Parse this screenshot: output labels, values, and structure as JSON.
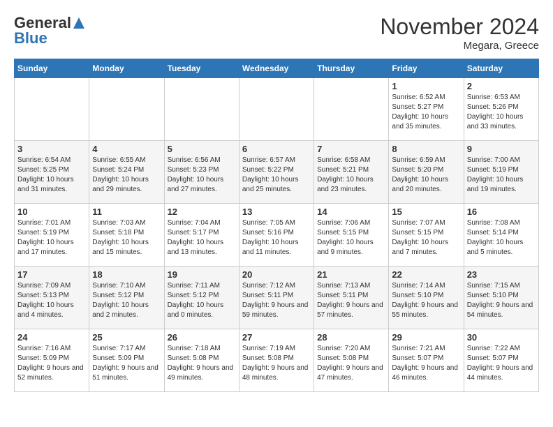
{
  "header": {
    "logo_general": "General",
    "logo_blue": "Blue",
    "month": "November 2024",
    "location": "Megara, Greece"
  },
  "weekdays": [
    "Sunday",
    "Monday",
    "Tuesday",
    "Wednesday",
    "Thursday",
    "Friday",
    "Saturday"
  ],
  "weeks": [
    [
      {
        "day": "",
        "info": ""
      },
      {
        "day": "",
        "info": ""
      },
      {
        "day": "",
        "info": ""
      },
      {
        "day": "",
        "info": ""
      },
      {
        "day": "",
        "info": ""
      },
      {
        "day": "1",
        "info": "Sunrise: 6:52 AM\nSunset: 5:27 PM\nDaylight: 10 hours and 35 minutes."
      },
      {
        "day": "2",
        "info": "Sunrise: 6:53 AM\nSunset: 5:26 PM\nDaylight: 10 hours and 33 minutes."
      }
    ],
    [
      {
        "day": "3",
        "info": "Sunrise: 6:54 AM\nSunset: 5:25 PM\nDaylight: 10 hours and 31 minutes."
      },
      {
        "day": "4",
        "info": "Sunrise: 6:55 AM\nSunset: 5:24 PM\nDaylight: 10 hours and 29 minutes."
      },
      {
        "day": "5",
        "info": "Sunrise: 6:56 AM\nSunset: 5:23 PM\nDaylight: 10 hours and 27 minutes."
      },
      {
        "day": "6",
        "info": "Sunrise: 6:57 AM\nSunset: 5:22 PM\nDaylight: 10 hours and 25 minutes."
      },
      {
        "day": "7",
        "info": "Sunrise: 6:58 AM\nSunset: 5:21 PM\nDaylight: 10 hours and 23 minutes."
      },
      {
        "day": "8",
        "info": "Sunrise: 6:59 AM\nSunset: 5:20 PM\nDaylight: 10 hours and 20 minutes."
      },
      {
        "day": "9",
        "info": "Sunrise: 7:00 AM\nSunset: 5:19 PM\nDaylight: 10 hours and 19 minutes."
      }
    ],
    [
      {
        "day": "10",
        "info": "Sunrise: 7:01 AM\nSunset: 5:19 PM\nDaylight: 10 hours and 17 minutes."
      },
      {
        "day": "11",
        "info": "Sunrise: 7:03 AM\nSunset: 5:18 PM\nDaylight: 10 hours and 15 minutes."
      },
      {
        "day": "12",
        "info": "Sunrise: 7:04 AM\nSunset: 5:17 PM\nDaylight: 10 hours and 13 minutes."
      },
      {
        "day": "13",
        "info": "Sunrise: 7:05 AM\nSunset: 5:16 PM\nDaylight: 10 hours and 11 minutes."
      },
      {
        "day": "14",
        "info": "Sunrise: 7:06 AM\nSunset: 5:15 PM\nDaylight: 10 hours and 9 minutes."
      },
      {
        "day": "15",
        "info": "Sunrise: 7:07 AM\nSunset: 5:15 PM\nDaylight: 10 hours and 7 minutes."
      },
      {
        "day": "16",
        "info": "Sunrise: 7:08 AM\nSunset: 5:14 PM\nDaylight: 10 hours and 5 minutes."
      }
    ],
    [
      {
        "day": "17",
        "info": "Sunrise: 7:09 AM\nSunset: 5:13 PM\nDaylight: 10 hours and 4 minutes."
      },
      {
        "day": "18",
        "info": "Sunrise: 7:10 AM\nSunset: 5:12 PM\nDaylight: 10 hours and 2 minutes."
      },
      {
        "day": "19",
        "info": "Sunrise: 7:11 AM\nSunset: 5:12 PM\nDaylight: 10 hours and 0 minutes."
      },
      {
        "day": "20",
        "info": "Sunrise: 7:12 AM\nSunset: 5:11 PM\nDaylight: 9 hours and 59 minutes."
      },
      {
        "day": "21",
        "info": "Sunrise: 7:13 AM\nSunset: 5:11 PM\nDaylight: 9 hours and 57 minutes."
      },
      {
        "day": "22",
        "info": "Sunrise: 7:14 AM\nSunset: 5:10 PM\nDaylight: 9 hours and 55 minutes."
      },
      {
        "day": "23",
        "info": "Sunrise: 7:15 AM\nSunset: 5:10 PM\nDaylight: 9 hours and 54 minutes."
      }
    ],
    [
      {
        "day": "24",
        "info": "Sunrise: 7:16 AM\nSunset: 5:09 PM\nDaylight: 9 hours and 52 minutes."
      },
      {
        "day": "25",
        "info": "Sunrise: 7:17 AM\nSunset: 5:09 PM\nDaylight: 9 hours and 51 minutes."
      },
      {
        "day": "26",
        "info": "Sunrise: 7:18 AM\nSunset: 5:08 PM\nDaylight: 9 hours and 49 minutes."
      },
      {
        "day": "27",
        "info": "Sunrise: 7:19 AM\nSunset: 5:08 PM\nDaylight: 9 hours and 48 minutes."
      },
      {
        "day": "28",
        "info": "Sunrise: 7:20 AM\nSunset: 5:08 PM\nDaylight: 9 hours and 47 minutes."
      },
      {
        "day": "29",
        "info": "Sunrise: 7:21 AM\nSunset: 5:07 PM\nDaylight: 9 hours and 46 minutes."
      },
      {
        "day": "30",
        "info": "Sunrise: 7:22 AM\nSunset: 5:07 PM\nDaylight: 9 hours and 44 minutes."
      }
    ]
  ]
}
